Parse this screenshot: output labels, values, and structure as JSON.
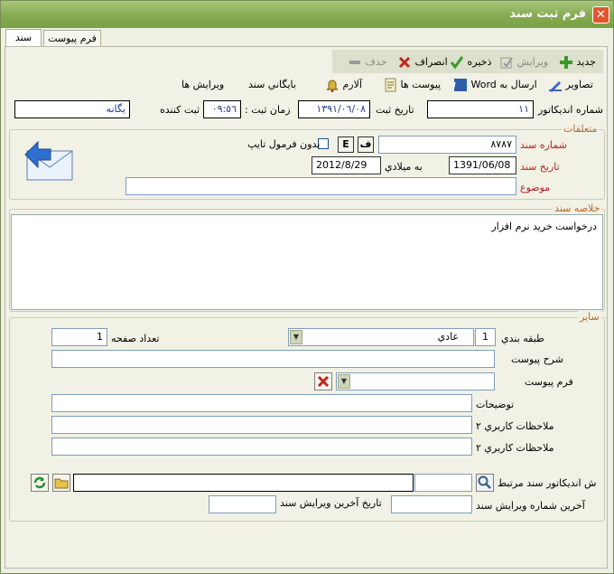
{
  "window": {
    "title": "فرم ثبت سند"
  },
  "tabs": [
    {
      "label": "سند"
    },
    {
      "label": "فرم پيوست"
    }
  ],
  "toolbar": {
    "new": "جديد",
    "edit": "ويرايش",
    "save": "ذخيره",
    "cancel": "انصراف",
    "delete": "حذف",
    "images": "تصاوير",
    "send_word": "ارسال به Word",
    "attachments": "پيوست ها",
    "alarm": "آلارم",
    "archive": "بايگاني سند",
    "doc_edits": "ويرايش ها"
  },
  "header": {
    "indicator_label": "شماره انديكاتور",
    "indicator_value": "١١",
    "reg_date_label": "تاريخ ثبت",
    "reg_date_value": "١٣٩١/٠٦/٠٨",
    "reg_time_label": "زمان ثبت :",
    "reg_time_value": "٠٩:٥٦",
    "registrar_label": "ثبت كننده",
    "registrar_value": "يگانه"
  },
  "attachments": {
    "group_title": "متعلقات",
    "doc_number_label": "شماره سند",
    "doc_number_value": "٨٧٨٧",
    "f_button": "ف",
    "e_button": "E",
    "no_format_label": "بدون فرمول تايپ",
    "doc_date_label": "تاريخ سند",
    "doc_date_value": "1391/06/08",
    "gregorian_label": "به ميلادي",
    "gregorian_value": "2012/8/29",
    "subject_label": "موضوع",
    "subject_value": ""
  },
  "summary": {
    "group_title": "خلاصه سند",
    "text": "درخواست خريد نرم افزار"
  },
  "other": {
    "group_title": "ساير",
    "classification_label": "طبقه بندي",
    "classification_num": "1",
    "classification_value": "عادي",
    "page_count_label": "تعداد صفحه",
    "page_count_value": "1",
    "attach_desc_label": "شرح پيوست",
    "attach_form_label": "فرم پيوست",
    "notes_label": "توضيحات",
    "user_notes1_label": "ملاحظات كاربري ٢",
    "user_notes2_label": "ملاحظات كاربري ٢",
    "related_indicator_label": "ش انديكاتور سند مرتبط",
    "last_edit_number_label": "آخرين شماره ويرايش سند",
    "last_edit_date_label": "تاريخ آخرين ويرايش سند"
  }
}
